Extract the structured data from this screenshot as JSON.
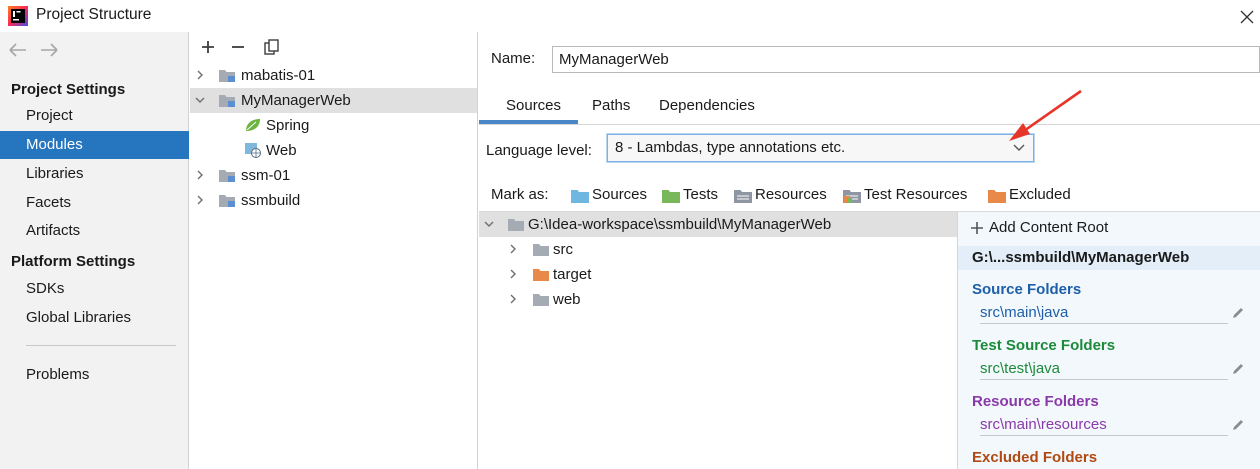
{
  "window": {
    "title": "Project Structure",
    "close_icon": "close-icon"
  },
  "nav": {
    "back_icon": "arrow-left-icon",
    "forward_icon": "arrow-right-icon",
    "project_settings_header": "Project Settings",
    "project_settings_items": [
      "Project",
      "Modules",
      "Libraries",
      "Facets",
      "Artifacts"
    ],
    "selected_item": "Modules",
    "platform_settings_header": "Platform Settings",
    "platform_settings_items": [
      "SDKs",
      "Global Libraries"
    ],
    "problems": "Problems"
  },
  "module_tree": {
    "toolbar": [
      "add-icon",
      "remove-icon",
      "copy-icon"
    ],
    "items": [
      {
        "label": "mabatis-01",
        "expanded": false,
        "icon": "module-folder-icon"
      },
      {
        "label": "MyManagerWeb",
        "expanded": true,
        "selected": true,
        "icon": "module-folder-icon"
      },
      {
        "label": "Spring",
        "icon": "spring-leaf-icon"
      },
      {
        "label": "Web",
        "icon": "web-facet-icon"
      },
      {
        "label": "ssm-01",
        "expanded": false,
        "icon": "module-folder-icon"
      },
      {
        "label": "ssmbuild",
        "expanded": false,
        "icon": "module-folder-icon"
      }
    ]
  },
  "main": {
    "name_label": "Name:",
    "name_value": "MyManagerWeb",
    "tabs": [
      {
        "label": "Sources",
        "active": true
      },
      {
        "label": "Paths",
        "active": false
      },
      {
        "label": "Dependencies",
        "active": false
      }
    ],
    "language_level_label": "Language level:",
    "language_level_value": "8 - Lambdas, type annotations etc.",
    "mark_as_label": "Mark as:",
    "mark_as": [
      {
        "label": "Sources",
        "color": "#6fb6e0"
      },
      {
        "label": "Tests",
        "color": "#78b85a"
      },
      {
        "label": "Resources",
        "color": "#8f96a3"
      },
      {
        "label": "Test Resources",
        "color": "#8f96a3"
      },
      {
        "label": "Excluded",
        "color": "#e8894a"
      }
    ],
    "content_tree": [
      {
        "label": "G:\\Idea-workspace\\ssmbuild\\MyManagerWeb",
        "selected": true,
        "expanded": true
      },
      {
        "label": "src",
        "color": "#a5abb3"
      },
      {
        "label": "target",
        "color": "#e8894a"
      },
      {
        "label": "web",
        "color": "#a5abb3"
      }
    ]
  },
  "info_panel": {
    "add_content_root": "Add Content Root",
    "root_path": "G:\\...ssmbuild\\MyManagerWeb",
    "source_folders_header": "Source Folders",
    "source_folder_path": "src\\main\\java",
    "test_source_folders_header": "Test Source Folders",
    "test_source_folder_path": "src\\test\\java",
    "resource_folders_header": "Resource Folders",
    "resource_folder_path": "src\\main\\resources",
    "excluded_folders_header": "Excluded Folders",
    "colors": {
      "source": "#1e5fa8",
      "test": "#1d8a3a",
      "resource": "#8a3aa8",
      "excluded": "#b04a12"
    }
  },
  "accent": "#2675bf"
}
